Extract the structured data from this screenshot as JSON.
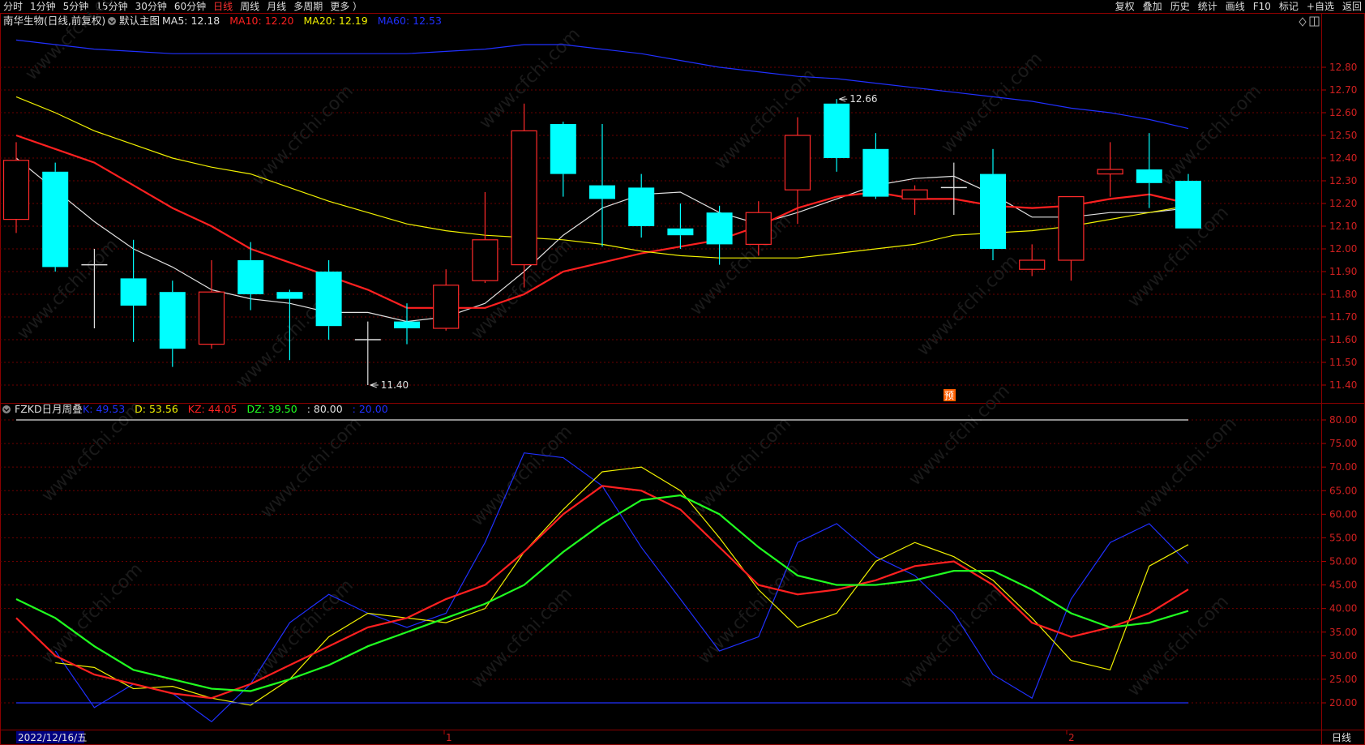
{
  "toolbar": {
    "periods": [
      "分时",
      "1分钟",
      "5分钟",
      "15分钟",
      "30分钟",
      "60分钟",
      "日线",
      "周线",
      "月线",
      "多周期",
      "更多 ）"
    ],
    "active_period": "日线",
    "right_items": [
      "复权",
      "叠加",
      "历史",
      "统计",
      "画线",
      "F10",
      "标记",
      "+自选",
      "返回"
    ]
  },
  "main_panel": {
    "stock_title": "南华生物(日线,前复权)",
    "template_label": "默认主图",
    "ma_legend": [
      {
        "text": "MA5: 12.18",
        "color": "#e0e0e0"
      },
      {
        "text": "MA10: 12.20",
        "color": "#ff2020"
      },
      {
        "text": "MA20: 12.19",
        "color": "#f0f000"
      },
      {
        "text": "MA60: 12.53",
        "color": "#2030ff"
      }
    ],
    "high_label": "12.66",
    "low_label": "11.40",
    "badge": "预"
  },
  "indicator_panel": {
    "title": "FZKD日月周叠",
    "legend": [
      {
        "text": "K: 49.53",
        "color": "#2030ff"
      },
      {
        "text": "D: 53.56",
        "color": "#f0f000"
      },
      {
        "text": "KZ: 44.05",
        "color": "#ff2020"
      },
      {
        "text": "DZ: 39.50",
        "color": "#20ff20"
      },
      {
        "text": ": 80.00",
        "color": "#e0e0e0"
      },
      {
        "text": ": 20.00",
        "color": "#2030ff"
      }
    ]
  },
  "bottom_bar": {
    "date_label": "2022/12/16/五",
    "month_marks": [
      "1",
      "2"
    ],
    "period_label": "日线"
  },
  "chart_data": [
    {
      "type": "candlestick",
      "ylim": [
        11.35,
        12.92
      ],
      "y_ticks": [
        "12.80",
        "12.70",
        "12.60",
        "12.50",
        "12.40",
        "12.30",
        "12.20",
        "12.10",
        "12.00",
        "11.90",
        "11.80",
        "11.70",
        "11.60",
        "11.50",
        "11.40"
      ],
      "candles": [
        {
          "o": 12.13,
          "h": 12.47,
          "l": 12.07,
          "c": 12.39
        },
        {
          "o": 12.34,
          "h": 12.38,
          "l": 11.9,
          "c": 11.92
        },
        {
          "o": 11.93,
          "h": 12.0,
          "l": 11.65,
          "c": 11.93
        },
        {
          "o": 11.87,
          "h": 12.04,
          "l": 11.59,
          "c": 11.75
        },
        {
          "o": 11.81,
          "h": 11.86,
          "l": 11.48,
          "c": 11.56
        },
        {
          "o": 11.58,
          "h": 11.95,
          "l": 11.56,
          "c": 11.81
        },
        {
          "o": 11.95,
          "h": 12.03,
          "l": 11.73,
          "c": 11.8
        },
        {
          "o": 11.81,
          "h": 11.82,
          "l": 11.51,
          "c": 11.78
        },
        {
          "o": 11.9,
          "h": 11.95,
          "l": 11.6,
          "c": 11.66
        },
        {
          "o": 11.6,
          "h": 11.68,
          "l": 11.4,
          "c": 11.6
        },
        {
          "o": 11.68,
          "h": 11.76,
          "l": 11.58,
          "c": 11.65
        },
        {
          "o": 11.65,
          "h": 11.91,
          "l": 11.64,
          "c": 11.84
        },
        {
          "o": 11.86,
          "h": 12.25,
          "l": 11.85,
          "c": 12.04
        },
        {
          "o": 11.93,
          "h": 12.64,
          "l": 11.83,
          "c": 12.52
        },
        {
          "o": 12.55,
          "h": 12.56,
          "l": 12.23,
          "c": 12.33
        },
        {
          "o": 12.28,
          "h": 12.55,
          "l": 12.01,
          "c": 12.22
        },
        {
          "o": 12.27,
          "h": 12.33,
          "l": 12.05,
          "c": 12.1
        },
        {
          "o": 12.09,
          "h": 12.2,
          "l": 12.0,
          "c": 12.06
        },
        {
          "o": 12.16,
          "h": 12.19,
          "l": 11.93,
          "c": 12.02
        },
        {
          "o": 12.02,
          "h": 12.21,
          "l": 11.97,
          "c": 12.16
        },
        {
          "o": 12.26,
          "h": 12.58,
          "l": 12.11,
          "c": 12.5
        },
        {
          "o": 12.64,
          "h": 12.66,
          "l": 12.34,
          "c": 12.4
        },
        {
          "o": 12.44,
          "h": 12.51,
          "l": 12.22,
          "c": 12.23
        },
        {
          "o": 12.22,
          "h": 12.28,
          "l": 12.15,
          "c": 12.26
        },
        {
          "o": 12.27,
          "h": 12.38,
          "l": 12.15,
          "c": 12.27
        },
        {
          "o": 12.33,
          "h": 12.44,
          "l": 11.95,
          "c": 12.0
        },
        {
          "o": 11.91,
          "h": 12.02,
          "l": 11.88,
          "c": 11.95
        },
        {
          "o": 11.95,
          "h": 12.23,
          "l": 11.86,
          "c": 12.23
        },
        {
          "o": 12.33,
          "h": 12.47,
          "l": 12.23,
          "c": 12.35
        },
        {
          "o": 12.35,
          "h": 12.51,
          "l": 12.18,
          "c": 12.29
        },
        {
          "o": 12.3,
          "h": 12.33,
          "l": 12.09,
          "c": 12.09
        }
      ],
      "series": [
        {
          "name": "MA5",
          "color": "#e0e0e0",
          "values": [
            12.4,
            12.26,
            12.12,
            12.0,
            11.92,
            11.82,
            11.78,
            11.76,
            11.72,
            11.72,
            11.68,
            11.7,
            11.76,
            11.9,
            12.06,
            12.18,
            12.24,
            12.25,
            12.16,
            12.11,
            12.16,
            12.22,
            12.28,
            12.31,
            12.32,
            12.24,
            12.14,
            12.14,
            12.16,
            12.16,
            12.18
          ]
        },
        {
          "name": "MA10",
          "color": "#ff2020",
          "values": [
            12.5,
            12.44,
            12.38,
            12.28,
            12.18,
            12.1,
            12.0,
            11.94,
            11.88,
            11.82,
            11.74,
            11.74,
            11.74,
            11.8,
            11.9,
            11.94,
            11.98,
            12.01,
            12.04,
            12.1,
            12.18,
            12.23,
            12.25,
            12.22,
            12.22,
            12.19,
            12.18,
            12.19,
            12.22,
            12.24,
            12.2
          ]
        },
        {
          "name": "MA20",
          "color": "#f0f000",
          "values": [
            12.67,
            12.6,
            12.52,
            12.46,
            12.4,
            12.36,
            12.33,
            12.27,
            12.21,
            12.16,
            12.11,
            12.08,
            12.06,
            12.05,
            12.04,
            12.02,
            11.99,
            11.97,
            11.96,
            11.96,
            11.96,
            11.98,
            12.0,
            12.02,
            12.06,
            12.07,
            12.08,
            12.1,
            12.13,
            12.16,
            12.19
          ]
        },
        {
          "name": "MA60",
          "color": "#2030ff",
          "values": [
            12.92,
            12.9,
            12.88,
            12.87,
            12.86,
            12.86,
            12.86,
            12.86,
            12.86,
            12.86,
            12.86,
            12.87,
            12.88,
            12.9,
            12.9,
            12.88,
            12.86,
            12.83,
            12.8,
            12.78,
            12.76,
            12.75,
            12.73,
            12.71,
            12.69,
            12.67,
            12.65,
            12.62,
            12.6,
            12.57,
            12.53
          ]
        }
      ]
    },
    {
      "type": "line",
      "ylim": [
        15,
        82
      ],
      "y_ticks": [
        "80.00",
        "75.00",
        "70.00",
        "65.00",
        "60.00",
        "55.00",
        "50.00",
        "45.00",
        "40.00",
        "35.00",
        "30.00",
        "25.00",
        "20.00"
      ],
      "series": [
        {
          "name": "K",
          "color": "#2030ff",
          "values": [
            31,
            19,
            24,
            22,
            16,
            24,
            37,
            43,
            39,
            36,
            39,
            54,
            73,
            72,
            66,
            53,
            42,
            31,
            34,
            54,
            58,
            51,
            47,
            39,
            26,
            21,
            42,
            54,
            58,
            49.53
          ]
        },
        {
          "name": "D",
          "color": "#f0f000",
          "values": [
            28.5,
            27.5,
            23,
            23.5,
            21,
            19.5,
            25,
            34,
            39,
            38,
            37,
            40,
            52,
            61,
            69,
            70,
            65,
            55,
            44,
            36,
            39,
            50,
            54,
            51,
            46,
            38,
            29,
            27,
            49,
            53.56
          ]
        },
        {
          "name": "KZ",
          "color": "#ff2020",
          "values": [
            38,
            30,
            26,
            24,
            22,
            21,
            24,
            28,
            32,
            36,
            38,
            42,
            45,
            52,
            60,
            66,
            65,
            61,
            53,
            45,
            43,
            44,
            46,
            49,
            50,
            45,
            37,
            34,
            36,
            39,
            44.05
          ]
        },
        {
          "name": "DZ",
          "color": "#20ff20",
          "values": [
            42,
            38,
            32,
            27,
            25,
            23,
            22.5,
            25,
            28,
            32,
            35,
            38,
            41,
            45,
            52,
            58,
            63,
            64,
            60,
            53,
            47,
            45,
            45,
            46,
            48,
            48,
            44,
            39,
            36,
            37,
            39.5
          ]
        },
        {
          "name": "",
          "color": "#e0e0e0",
          "values": [
            80,
            80
          ]
        },
        {
          "name": "",
          "color": "#2030ff",
          "values": [
            20,
            20
          ]
        }
      ]
    }
  ]
}
